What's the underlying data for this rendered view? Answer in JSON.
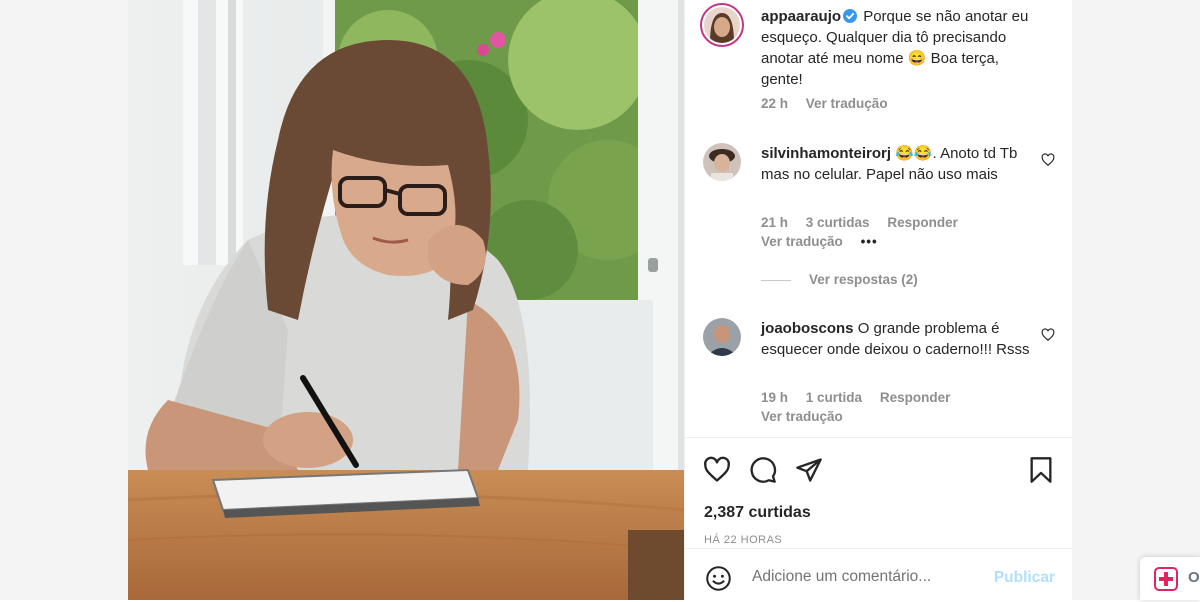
{
  "post": {
    "image_alt": "Woman with glasses writing in a notebook at a wooden table",
    "caption": {
      "username": "appaaraujo",
      "verified": true,
      "text": "Porque se não anotar eu esqueço. Qualquer dia tô precisando anotar até meu nome 😄 Boa terça, gente!",
      "time": "22 h",
      "translate": "Ver tradução"
    },
    "comments": [
      {
        "username": "silvinhamonteirorj",
        "text": "😂😂. Anoto td Tb mas no celular. Papel não uso mais",
        "time": "21 h",
        "likes": "3 curtidas",
        "reply": "Responder",
        "translate": "Ver tradução",
        "more": "•••"
      },
      {
        "username": "joaoboscons",
        "text": "O grande problema é esquecer onde deixou o caderno!!! Rsss",
        "time": "19 h",
        "likes": "1 curtida",
        "reply": "Responder",
        "translate": "Ver tradução"
      }
    ],
    "view_replies": "Ver respostas (2)",
    "likes_count": "2,387 curtidas",
    "posted_ago": "HÁ 22 HORAS",
    "comment_placeholder": "Adicione um comentário...",
    "publish_label": "Publicar"
  },
  "extension": {
    "label": "O"
  },
  "icons": [
    "like-icon",
    "comment-icon",
    "share-icon",
    "save-icon",
    "emoji-icon",
    "verified-icon",
    "heart-small-icon"
  ],
  "colors": {
    "verified": "#3897f0",
    "publish": "#b2dffc",
    "muted": "#8e8e8e"
  }
}
